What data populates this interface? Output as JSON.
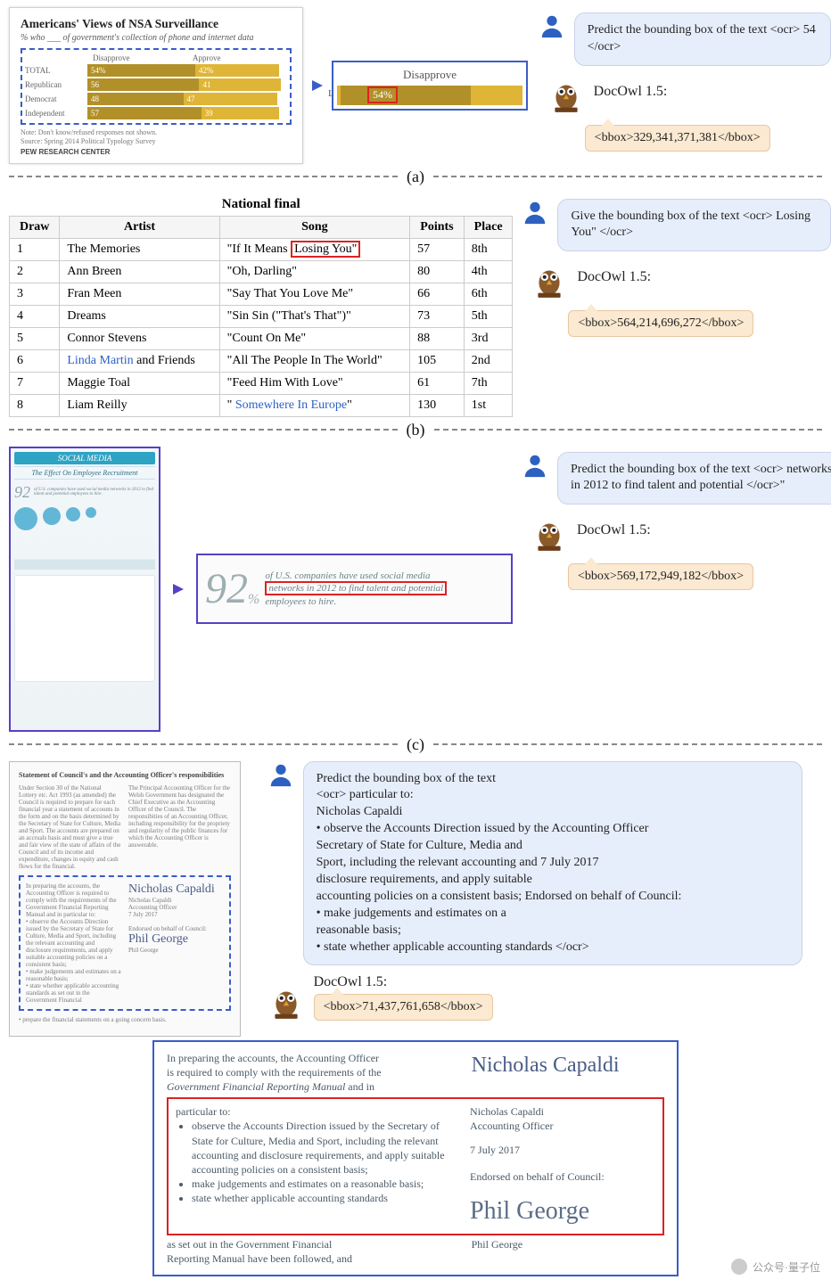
{
  "dividers": {
    "a": "(a)",
    "b": "(b)",
    "c": "(c)"
  },
  "owl_label": "DocOwl 1.5:",
  "a": {
    "user_prompt": "Predict the bounding box of the text <ocr> 54 </ocr>",
    "owl_output": "<bbox>329,341,371,381</bbox>",
    "chart": {
      "title": "Americans' Views of NSA Surveillance",
      "subtitle": "% who ___ of government's collection of phone and internet data",
      "col_dis": "Disapprove",
      "col_app": "Approve",
      "rows": [
        {
          "label": "TOTAL",
          "dis": "54%",
          "app": "42%"
        },
        {
          "label": "Republican",
          "dis": "56",
          "app": "41"
        },
        {
          "label": "Democrat",
          "dis": "48",
          "app": "47"
        },
        {
          "label": "Independent",
          "dis": "57",
          "app": "39"
        }
      ],
      "note": "Note: Don't know/refused responses not shown.",
      "source": "Source: Spring 2014 Political Typology Survey",
      "footer": "PEW RESEARCH CENTER"
    },
    "zoom": {
      "header": "Disapprove",
      "edge_label": "L",
      "value": "54%"
    }
  },
  "b": {
    "user_prompt": "Give the bounding box of the text <ocr> Losing You\" </ocr>",
    "owl_output": "<bbox>564,214,696,272</bbox>",
    "table": {
      "title": "National final",
      "headers": [
        "Draw",
        "Artist",
        "Song",
        "Points",
        "Place"
      ],
      "rows": [
        [
          "1",
          "The Memories",
          "\"If It Means Losing You\"",
          "57",
          "8th"
        ],
        [
          "2",
          "Ann Breen",
          "\"Oh, Darling\"",
          "80",
          "4th"
        ],
        [
          "3",
          "Fran Meen",
          "\"Say That You Love Me\"",
          "66",
          "6th"
        ],
        [
          "4",
          "Dreams",
          "\"Sin Sin (\"That's That\")\"",
          "73",
          "5th"
        ],
        [
          "5",
          "Connor Stevens",
          "\"Count On Me\"",
          "88",
          "3rd"
        ],
        [
          "6",
          "Linda Martin and Friends",
          "\"All The People In The World\"",
          "105",
          "2nd"
        ],
        [
          "7",
          "Maggie Toal",
          "\"Feed Him With Love\"",
          "61",
          "7th"
        ],
        [
          "8",
          "Liam Reilly",
          "\" Somewhere In Europe\"",
          "130",
          "1st"
        ]
      ]
    }
  },
  "c": {
    "user_prompt": "Predict the bounding box of the text <ocr> networks in 2012 to find talent and potential </ocr>\"",
    "owl_output": "<bbox>569,172,949,182</bbox>",
    "infog": {
      "heading": "SOCIAL MEDIA",
      "title": "The Effect On Employee Recruitment"
    },
    "zoom": {
      "n": "92",
      "pct": "%",
      "line1": "of U.S. companies have used social media",
      "line2_highlight": "networks in 2012 to find talent and potential",
      "line3": "employees to hire."
    }
  },
  "d": {
    "user_prompt": "Predict the bounding box of the text\n<ocr> particular to:\nNicholas Capaldi\n• observe the Accounts Direction issued by the Accounting Officer\nSecretary of State for Culture, Media and\nSport, including the relevant accounting and 7 July 2017\ndisclosure requirements, and apply suitable\naccounting policies on a consistent basis; Endorsed on behalf of Council:\n• make judgements and estimates on a\nreasonable basis;\n• state whether applicable accounting standards </ocr>",
    "owl_output": "<bbox>71,437,761,658</bbox>",
    "doc": {
      "heading": "Statement of Council's and the Accounting Officer's responsibilities",
      "sig1": "Nicholas Capaldi",
      "sig2": "Phil George"
    },
    "zoom": {
      "pre1": "In preparing the accounts, the Accounting Officer",
      "pre2": "is required to comply with the requirements of the",
      "pre3_italic": "Government Financial Reporting Manual",
      "pre3_tail": " and in",
      "r1": "particular to:",
      "b1": "observe the Accounts Direction issued by the Secretary of State for Culture, Media and Sport, including the relevant accounting and disclosure requirements, and apply suitable accounting policies on a consistent basis;",
      "b2": "make judgements and estimates on a reasonable basis;",
      "b3": "state whether applicable accounting standards",
      "post1": "as set out in the Government Financial",
      "post2": "Reporting Manual have been followed, and",
      "name1": "Nicholas Capaldi",
      "role1": "Accounting Officer",
      "date1": "7 July 2017",
      "endorse": "Endorsed on behalf of Council:",
      "name2": "Phil George"
    }
  },
  "watermark": "公众号·量子位",
  "chart_data": [
    {
      "type": "bar",
      "title": "Americans' Views of NSA Surveillance",
      "subtitle": "% who ___ of government's collection of phone and internet data",
      "categories": [
        "TOTAL",
        "Republican",
        "Democrat",
        "Independent"
      ],
      "series": [
        {
          "name": "Disapprove",
          "values": [
            54,
            56,
            48,
            57
          ]
        },
        {
          "name": "Approve",
          "values": [
            42,
            41,
            47,
            39
          ]
        }
      ],
      "xlabel": "%",
      "ylabel": "",
      "orientation": "horizontal",
      "source": "Spring 2014 Political Typology Survey / Pew Research Center"
    },
    {
      "type": "table",
      "title": "National final",
      "columns": [
        "Draw",
        "Artist",
        "Song",
        "Points",
        "Place"
      ],
      "rows": [
        [
          1,
          "The Memories",
          "If It Means Losing You",
          57,
          "8th"
        ],
        [
          2,
          "Ann Breen",
          "Oh, Darling",
          80,
          "4th"
        ],
        [
          3,
          "Fran Meen",
          "Say That You Love Me",
          66,
          "6th"
        ],
        [
          4,
          "Dreams",
          "Sin Sin (That's That)",
          73,
          "5th"
        ],
        [
          5,
          "Connor Stevens",
          "Count On Me",
          88,
          "3rd"
        ],
        [
          6,
          "Linda Martin and Friends",
          "All The People In The World",
          105,
          "2nd"
        ],
        [
          7,
          "Maggie Toal",
          "Feed Him With Love",
          61,
          "7th"
        ],
        [
          8,
          "Liam Reilly",
          "Somewhere In Europe",
          130,
          "1st"
        ]
      ]
    }
  ]
}
